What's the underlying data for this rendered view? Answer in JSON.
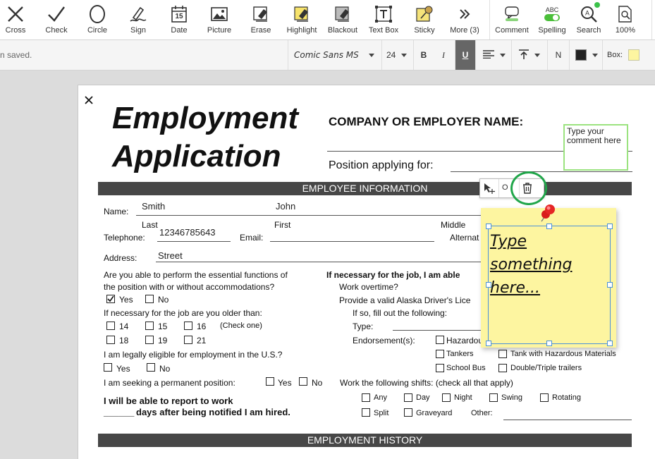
{
  "toolbar": {
    "tools": [
      {
        "label": "Cross",
        "icon": "cross-icon"
      },
      {
        "label": "Check",
        "icon": "check-icon"
      },
      {
        "label": "Circle",
        "icon": "circle-icon"
      },
      {
        "label": "Sign",
        "icon": "sign-icon"
      },
      {
        "label": "Date",
        "icon": "calendar-icon",
        "date_number": "15"
      },
      {
        "label": "Picture",
        "icon": "picture-icon"
      },
      {
        "label": "Erase",
        "icon": "eraser-icon"
      },
      {
        "label": "Highlight",
        "icon": "highlight-icon"
      },
      {
        "label": "Blackout",
        "icon": "blackout-icon"
      },
      {
        "label": "Text Box",
        "icon": "textbox-icon"
      },
      {
        "label": "Sticky",
        "icon": "sticky-icon"
      },
      {
        "label": "More (3)",
        "icon": "double-chevron-icon"
      },
      {
        "label": "Comment",
        "icon": "comment-icon"
      },
      {
        "label": "Spelling",
        "icon": "spelling-toggle-icon",
        "badge": "ABC"
      },
      {
        "label": "Search",
        "icon": "search-icon"
      },
      {
        "label": "100%",
        "icon": "zoom-icon"
      }
    ]
  },
  "format": {
    "status": "n saved.",
    "font": "Comic Sans MS",
    "size": "24",
    "bold": "B",
    "italic": "I",
    "underline": "U",
    "n_label": "N",
    "box_label": "Box:",
    "box_color": "#fdf5a0",
    "text_color": "#222222"
  },
  "document": {
    "title_line1": "Employment",
    "title_line2": "Application",
    "company_label": "COMPANY OR EMPLOYER NAME:",
    "position_label": "Position applying for:",
    "comment_placeholder": "Type your comment here",
    "section1": "EMPLOYEE INFORMATION",
    "section2": "EMPLOYMENT HISTORY",
    "name_label": "Name:",
    "name_last_value": "Smith",
    "name_first_value": "John",
    "sub_last": "Last",
    "sub_first": "First",
    "sub_middle": "Middle",
    "telephone_label": "Telephone:",
    "telephone_value": "12346785643",
    "email_label": "Email:",
    "alternate_label": "Alternat",
    "address_label": "Address:",
    "address_value": "Street",
    "q_essential_1": "Are you able to perform the essential functions of",
    "q_essential_2": "the position with or without accommodations?",
    "yes": "Yes",
    "no": "No",
    "q_older": "If necessary for the job are you older than:",
    "age_14": "14",
    "age_15": "15",
    "age_16": "16",
    "check_one": "(Check one)",
    "age_18": "18",
    "age_19": "19",
    "age_21": "21",
    "q_eligible": "I am legally eligible for employment in the U.S.?",
    "q_permanent": "I am seeking a permanent position:",
    "q_report_1": "I will be able to report to work",
    "q_report_2": "days after being notified I am hired.",
    "report_blank": "______",
    "r_if_necessary": "If necessary for the job, I am able",
    "r_overtime": "Work overtime?",
    "r_license": "Provide a valid Alaska Driver's Lice",
    "r_if_so": "If so, fill out the following:",
    "r_type": "Type:",
    "r_endorsement": "Endorsement(s):",
    "r_hazardous": "Hazardou",
    "r_tankers": "Tankers",
    "r_tank_hazard": "Tank with Hazardous Materials",
    "r_school_bus": "School Bus",
    "r_double_triple": "Double/Triple trailers",
    "r_shifts": "Work the following shifts: (check all that apply)",
    "shift_any": "Any",
    "shift_day": "Day",
    "shift_night": "Night",
    "shift_swing": "Swing",
    "shift_rotating": "Rotating",
    "shift_split": "Split",
    "shift_graveyard": "Graveyard",
    "shift_other": "Other:"
  },
  "sticky": {
    "text_line1": "Type",
    "text_line2": "something",
    "text_line3": "here...",
    "ok_label": "O"
  }
}
